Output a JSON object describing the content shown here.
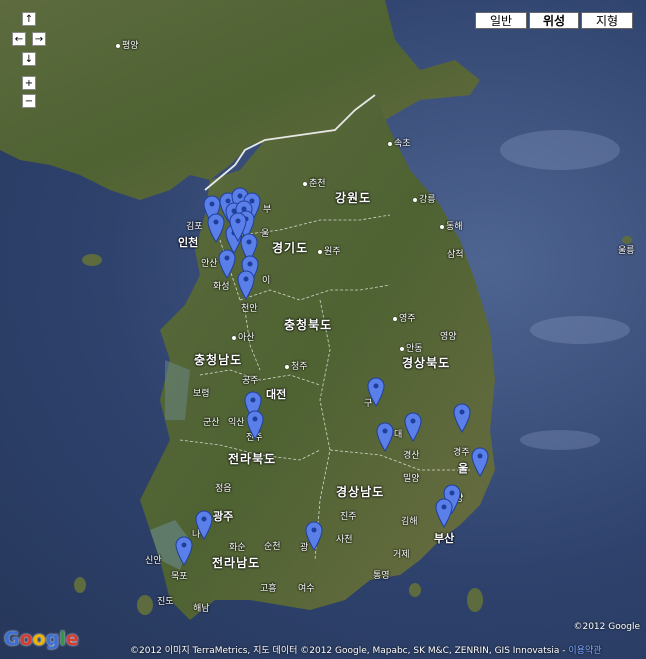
{
  "map_type_buttons": [
    {
      "label": "일반",
      "selected": false
    },
    {
      "label": "위성",
      "selected": true
    },
    {
      "label": "지형",
      "selected": false
    }
  ],
  "nav": {
    "up": "↑",
    "left": "←",
    "right": "→",
    "down": "↓",
    "zoom_in": "+",
    "zoom_out": "−"
  },
  "labels": {
    "pyongyang": "평양",
    "sokcho": "속초",
    "chuncheon": "춘천",
    "gangwondo": "강원도",
    "gangneung": "강릉",
    "gimpo": "김포",
    "seoul_partial": "울",
    "uijeongbu_partial": "부",
    "incheon": "인천",
    "gyeonggido": "경기도",
    "wonju": "원주",
    "donghae": "동해",
    "samcheok": "삼척",
    "ansan": "안산",
    "hwaseong": "화성",
    "icheon_partial": "이",
    "ulleung": "울릉",
    "cheonan": "천안",
    "chungcheongbukdo": "충청북도",
    "yeongju": "영주",
    "asan": "아산",
    "andong": "안동",
    "chungcheongnamdo": "충청남도",
    "cheongju": "청주",
    "yeongyang": "영양",
    "gyeongsangbukdo": "경상북도",
    "gongju": "공주",
    "daejeon": "대전",
    "boryeong": "보령",
    "gumi": "구",
    "daegu": "대",
    "gunsan": "군산",
    "iksan": "익산",
    "jeonju": "전주",
    "gyeongsan": "경산",
    "gyeongju": "경주",
    "pohang": "포항",
    "jeollabukdo": "전라북도",
    "ulsan": "울",
    "miryang": "밀양",
    "jeongeup": "정읍",
    "gyeongsangnamdo": "경상남도",
    "gwangju": "광주",
    "naju": "나",
    "jinju": "진주",
    "gimhae": "김해",
    "busan": "부산",
    "hwasun": "화순",
    "suncheon": "순천",
    "gwangyang": "광",
    "sacheon": "사천",
    "sinan": "신안",
    "jeollanamdo": "전라남도",
    "geoje": "거제",
    "mokpo": "목포",
    "tongyeong": "통영",
    "goheung": "고흥",
    "yeosu": "여수",
    "jindo": "진도",
    "haenam": "해남",
    "yangsan": "양"
  },
  "markers": [
    {
      "name": "seoul-1"
    },
    {
      "name": "seoul-2"
    },
    {
      "name": "seoul-3"
    },
    {
      "name": "seoul-4"
    },
    {
      "name": "seoul-5"
    },
    {
      "name": "seoul-6"
    },
    {
      "name": "seoul-7"
    },
    {
      "name": "seoul-8"
    },
    {
      "name": "seoul-9"
    },
    {
      "name": "seoul-10"
    },
    {
      "name": "gyeonggi-1"
    },
    {
      "name": "gyeonggi-2"
    },
    {
      "name": "gyeonggi-3"
    },
    {
      "name": "hwaseong-1"
    },
    {
      "name": "daejeon-1"
    },
    {
      "name": "jeonju-1"
    },
    {
      "name": "gumi-1"
    },
    {
      "name": "daegu-1"
    },
    {
      "name": "daegu-2"
    },
    {
      "name": "pohang-1"
    },
    {
      "name": "ulsan-1"
    },
    {
      "name": "busan-1"
    },
    {
      "name": "busan-2"
    },
    {
      "name": "gwangju-1"
    },
    {
      "name": "mokpo-1"
    },
    {
      "name": "gwangyang-1"
    }
  ],
  "marker_color": "#5b7fe8",
  "copyright_top": "©2012 Google",
  "copyright_bottom": "©2012 이미지 TerraMetrics, 지도 데이터 ©2012 Google, Mapabc, SK M&C, ZENRIN, GIS Innovatsia -",
  "terms_link": "이용약관",
  "logo_letters": [
    {
      "ch": "G",
      "color": "#3b6fd6"
    },
    {
      "ch": "o",
      "color": "#d83a2e"
    },
    {
      "ch": "o",
      "color": "#f0b400"
    },
    {
      "ch": "g",
      "color": "#3b6fd6"
    },
    {
      "ch": "l",
      "color": "#2d9b3e"
    },
    {
      "ch": "e",
      "color": "#d83a2e"
    }
  ]
}
